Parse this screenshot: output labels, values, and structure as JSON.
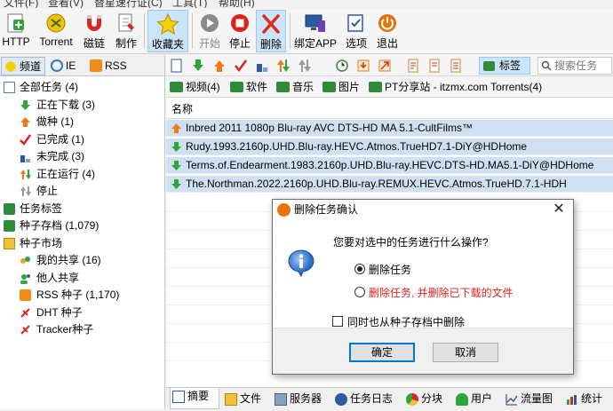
{
  "menubar": {
    "items": [
      "文件(F)",
      "查看(V)",
      "替星速行证(C)",
      "工具(T)",
      "帮助(H)"
    ]
  },
  "toolbar": {
    "buttons": [
      {
        "label": "HTTP",
        "icon": "http-add-icon"
      },
      {
        "label": "Torrent",
        "icon": "torrent-icon"
      },
      {
        "label": "磁链",
        "icon": "magnet-icon"
      },
      {
        "label": "制作",
        "icon": "make-torrent-icon"
      },
      {
        "label": "收藏夹",
        "icon": "star-icon"
      },
      {
        "label": "开始",
        "icon": "play-icon"
      },
      {
        "label": "停止",
        "icon": "stop-icon"
      },
      {
        "label": "删除",
        "icon": "delete-icon"
      },
      {
        "label": "绑定APP",
        "icon": "bind-app-icon"
      },
      {
        "label": "选项",
        "icon": "options-icon"
      },
      {
        "label": "退出",
        "icon": "exit-icon"
      }
    ]
  },
  "left_tabs": [
    "频道",
    "IE",
    "RSS"
  ],
  "tree": {
    "all_tasks": "全部任务 (4)",
    "downloading": "正在下载 (3)",
    "seeding": "做种 (1)",
    "completed": "已完成 (1)",
    "incomplete": "未完成 (3)",
    "running": "正在运行 (4)",
    "stopped": "停止",
    "task_tags": "任务标签",
    "seed_archive": "种子存档 (1,079)",
    "seed_market": "种子市场",
    "my_share": "我的共享 (16)",
    "others_share": "他人共享",
    "rss_seeds": "RSS 种子 (1,170)",
    "dht_seeds": "DHT 种子",
    "tracker_seeds": "Tracker种子"
  },
  "right_toolbar": {
    "tags_label": "标签",
    "search_placeholder": "搜索任务"
  },
  "categories": [
    "视频(4)",
    "软件",
    "音乐",
    "图片",
    "PT分享站 - itzmx.com Torrents(4)"
  ],
  "column_header": "名称",
  "tasks": [
    {
      "name": "Inbred 2011 1080p Blu-ray AVC DTS-HD MA 5.1-CultFilms™",
      "status": "seeding"
    },
    {
      "name": "Rudy.1993.2160p.UHD.Blu-ray.HEVC.Atmos.TrueHD7.1-DiY@HDHome",
      "status": "downloading"
    },
    {
      "name": "Terms.of.Endearment.1983.2160p.UHD.Blu-ray.HEVC.DTS-HD.MA5.1-DiY@HDHome",
      "status": "downloading"
    },
    {
      "name": "The.Northman.2022.2160p.UHD.Blu-ray.REMUX.HEVC.Atmos.TrueHD.7.1-HDH",
      "status": "downloading"
    }
  ],
  "bottom_tabs": [
    "摘要",
    "文件",
    "服务器",
    "任务日志",
    "分块",
    "用户",
    "流量图",
    "统计"
  ],
  "dialog": {
    "title": "删除任务确认",
    "question": "您要对选中的任务进行什么操作?",
    "option1": "删除任务",
    "option2": "删除任务, 并删除已下载的文件",
    "checkbox": "同时也从种子存档中删除",
    "ok": "确定",
    "cancel": "取消",
    "close": "✕",
    "selected_option": 1,
    "checkbox_checked": false
  },
  "colors": {
    "selection": "#cfe0f2",
    "warning_text": "#e02020",
    "accent": "#0078d7"
  }
}
